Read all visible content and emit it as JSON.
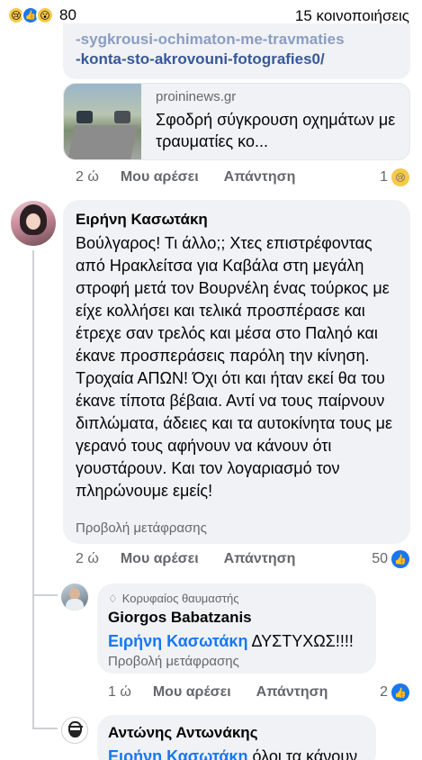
{
  "header": {
    "reactions": [
      {
        "icon": "sad-reaction-icon",
        "glyph": "😢"
      },
      {
        "icon": "like-reaction-icon",
        "glyph": "👍"
      },
      {
        "icon": "wow-reaction-icon",
        "glyph": "😮"
      }
    ],
    "reaction_count": "80",
    "shares": "15 κοινοποιήσεις"
  },
  "previous_comment": {
    "link_text_partial": "-sygkrousi-ochimaton-me-travmaties",
    "link_text": "-konta-sto-akrovouni-fotografies0/",
    "preview": {
      "source": "proininews.gr",
      "title": "Σφοδρή σύγκρουση οχημάτων με τραυματίες κο..."
    },
    "time": "2 ώ",
    "like_label": "Μου αρέσει",
    "reply_label": "Απάντηση",
    "reaction_count": "1",
    "reaction_icon": "😢"
  },
  "comment_1": {
    "author": "Ειρήνη Κασωτάκη",
    "text": "Βούλγαρος! Τι άλλο;; Χτες επιστρέφοντας από Ηρακλείτσα για Καβάλα στη μεγάλη στροφή μετά τον Βουρνέλη ένας τούρκος με είχε κολλήσει και τελικά προσπέρασε και έτρεχε σαν τρελός και μέσα στο Παληό και έκανε προσπεράσεις παρόλη την κίνηση. Τροχαία ΑΠΩΝ! Όχι ότι και ήταν εκεί θα του έκανε τίποτα βέβαια. Αντί να τους παίρνουν διπλώματα, άδειες και τα αυτοκίνητα τους με γερανό τους αφήνουν να κάνουν ότι γουστάρουν. Και τον λογαριασμό τον πληρώνουμε εμείς!",
    "see_translation": "Προβολή μετάφρασης",
    "time": "2 ώ",
    "like_label": "Μου αρέσει",
    "reply_label": "Απάντηση",
    "reaction_count": "50",
    "reaction_icon": "👍"
  },
  "reply_1": {
    "badge": "Κορυφαίος θαυμαστής",
    "badge_icon": "♢",
    "author": "Giorgos Babatzanis",
    "mention": "Ειρήνη Κασωτάκη",
    "text": " ΔΥΣΤΥΧΩΣ!!!!",
    "see_translation": "Προβολή μετάφρασης",
    "time": "1 ώ",
    "like_label": "Μου αρέσει",
    "reply_label": "Απάντηση",
    "reaction_count": "2",
    "reaction_icon": "👍"
  },
  "reply_2": {
    "author": "Αντώνης Αντωνάκης",
    "mention": "Ειρήνη Κασωτάκη",
    "text": " όλοι τα κάνουν"
  }
}
